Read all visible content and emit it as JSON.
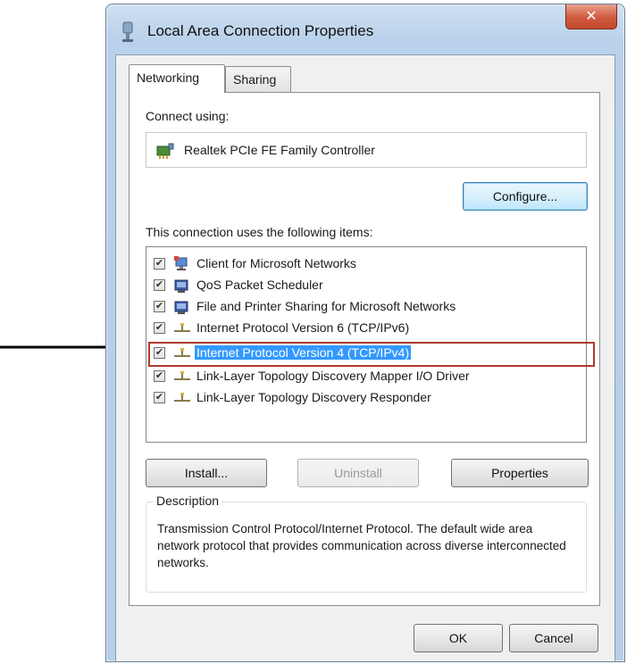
{
  "window": {
    "title": "Local Area Connection Properties",
    "close_label": "✕"
  },
  "tabs": [
    {
      "label": "Networking",
      "active": true
    },
    {
      "label": "Sharing",
      "active": false
    }
  ],
  "networking": {
    "connect_using_label": "Connect using:",
    "adapter_name": "Realtek PCIe FE Family Controller",
    "configure_label": "Configure...",
    "items_label": "This connection uses the following items:",
    "items": [
      {
        "label": "Client for Microsoft Networks",
        "checked": true,
        "icon": "network-client-icon"
      },
      {
        "label": "QoS Packet Scheduler",
        "checked": true,
        "icon": "network-service-icon"
      },
      {
        "label": "File and Printer Sharing for Microsoft Networks",
        "checked": true,
        "icon": "network-service-icon"
      },
      {
        "label": "Internet Protocol Version 6 (TCP/IPv6)",
        "checked": true,
        "icon": "protocol-icon"
      },
      {
        "label": "Internet Protocol Version 4 (TCP/IPv4)",
        "checked": true,
        "icon": "protocol-icon",
        "selected": true
      },
      {
        "label": "Link-Layer Topology Discovery Mapper I/O Driver",
        "checked": true,
        "icon": "protocol-icon"
      },
      {
        "label": "Link-Layer Topology Discovery Responder",
        "checked": true,
        "icon": "protocol-icon"
      }
    ],
    "install_label": "Install...",
    "uninstall_label": "Uninstall",
    "properties_label": "Properties",
    "description_title": "Description",
    "description_text": "Transmission Control Protocol/Internet Protocol. The default wide area network protocol that provides communication across diverse interconnected networks."
  },
  "footer": {
    "ok_label": "OK",
    "cancel_label": "Cancel"
  },
  "colors": {
    "selection": "#3399ff",
    "highlight_outline": "#b03a2e",
    "close_button": "#d05a3e"
  }
}
